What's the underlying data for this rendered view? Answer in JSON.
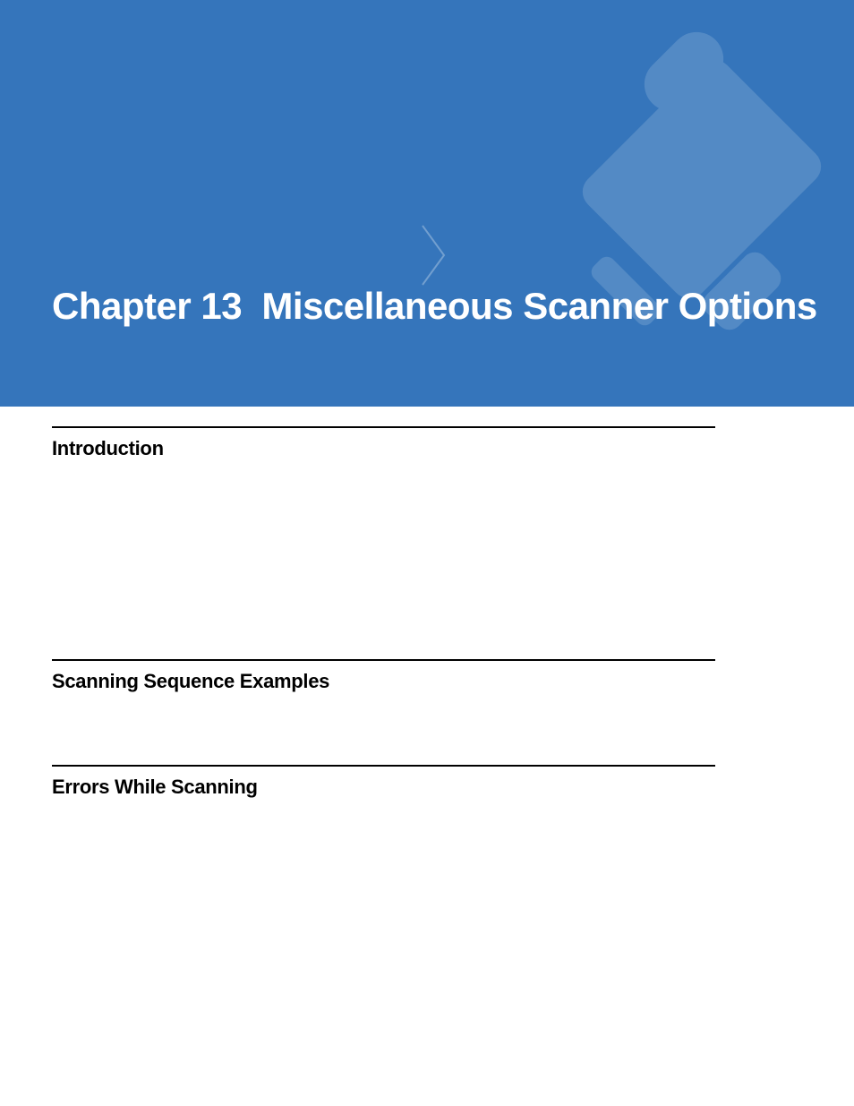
{
  "chapter": {
    "label": "Chapter 13",
    "title": "Miscellaneous Scanner Options"
  },
  "sections": [
    {
      "heading": "Introduction"
    },
    {
      "heading": "Scanning Sequence Examples"
    },
    {
      "heading": "Errors While Scanning"
    }
  ],
  "colors": {
    "banner": "#3575bb",
    "text_heading": "#000000",
    "banner_text": "#ffffff"
  }
}
